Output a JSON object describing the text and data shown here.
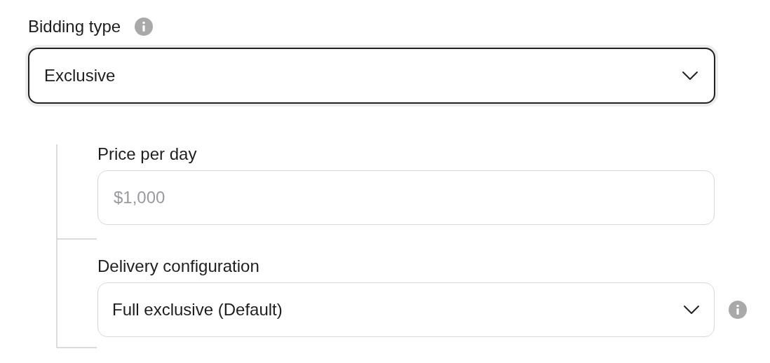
{
  "bidding_type": {
    "label": "Bidding type",
    "info": true,
    "value": "Exclusive",
    "focused": true
  },
  "children": [
    {
      "kind": "input",
      "label": "Price per day",
      "placeholder": "$1,000"
    },
    {
      "kind": "select",
      "label": "Delivery configuration",
      "value": "Full exclusive (Default)",
      "info": true
    }
  ]
}
